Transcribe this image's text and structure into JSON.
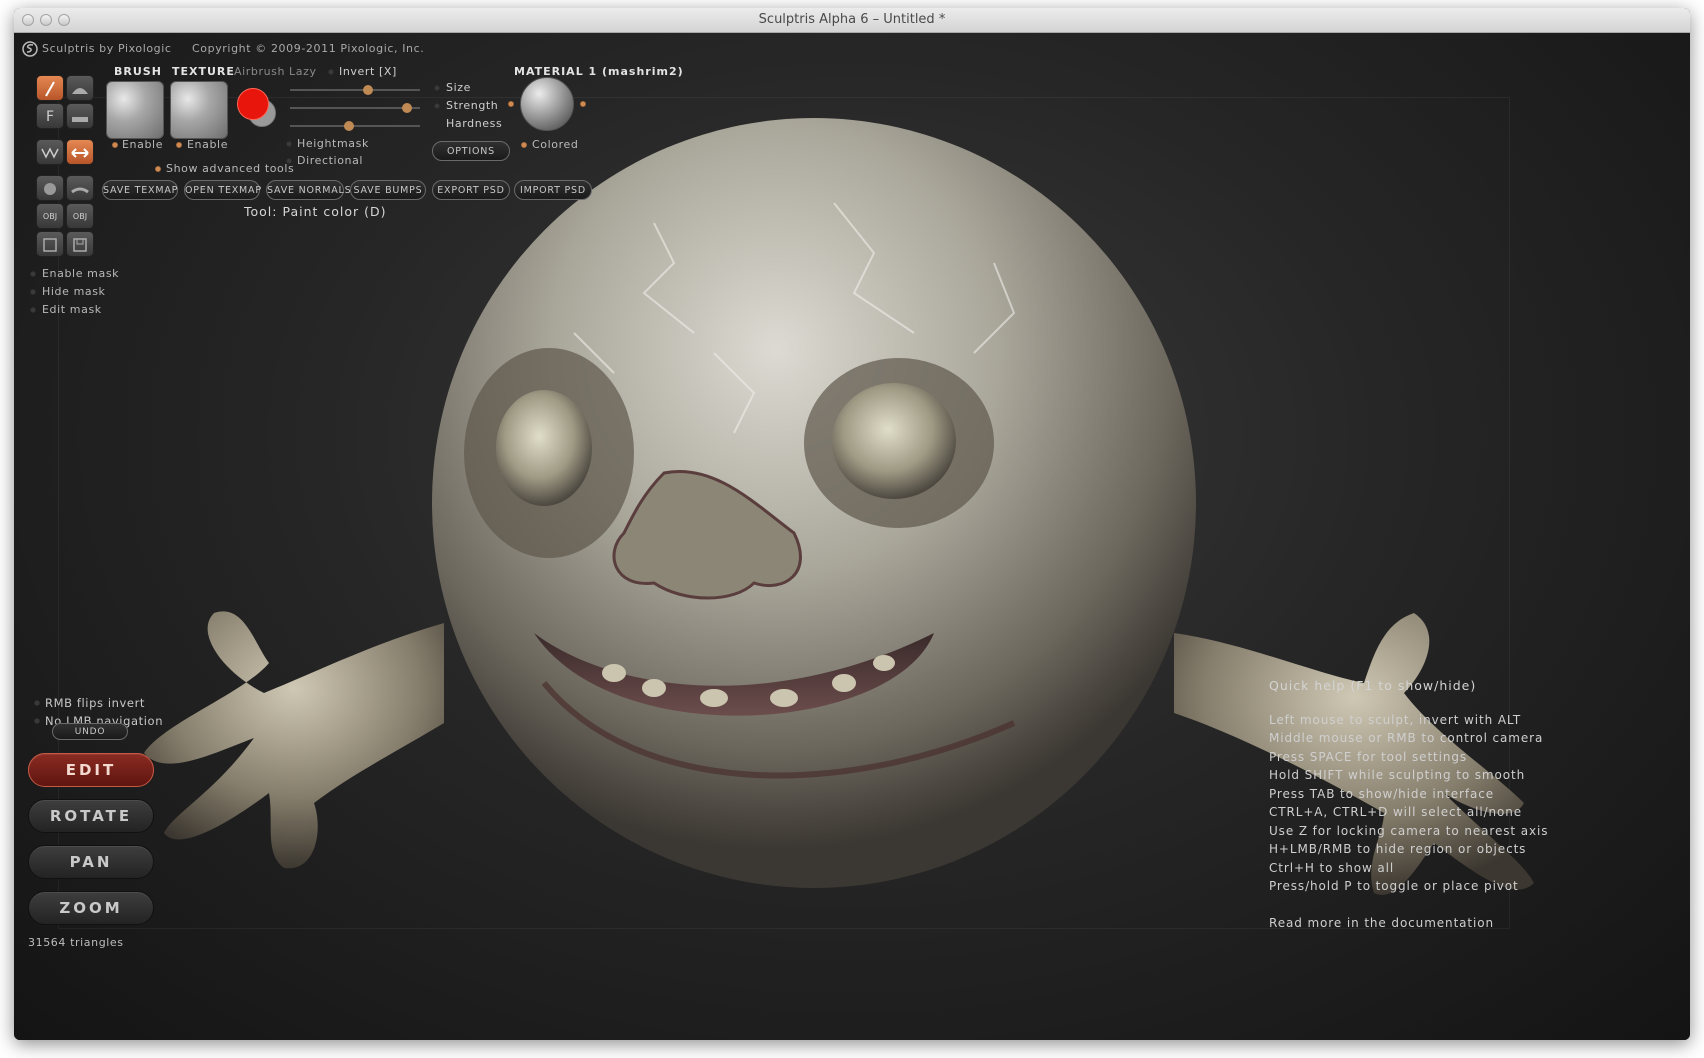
{
  "window": {
    "title": "Sculptris Alpha 6 – Untitled *"
  },
  "app_bar": {
    "title": "Sculptris by Pixologic",
    "copyright": "Copyright © 2009-2011 Pixologic, Inc."
  },
  "tools": {
    "brush_header": "BRUSH",
    "texture_header": "TEXTURE",
    "airbrush_label": "Airbrush",
    "lazy_label": "Lazy",
    "invert_label": "Invert [X]",
    "brush_enable": "Enable",
    "texture_enable": "Enable",
    "show_advanced": "Show advanced tools",
    "heightmask": "Heightmask",
    "directional": "Directional",
    "size_label": "Size",
    "strength_label": "Strength",
    "hardness_label": "Hardness",
    "size_value": 0.6,
    "strength_value": 0.9,
    "hardness_value": 0.45,
    "options_label": "OPTIONS",
    "material_header": "MATERIAL 1 (mashrim2)",
    "colored_label": "Colored",
    "paint_color": "#e8150c",
    "secondary_color": "#9a9a9a",
    "tool_status": "Tool: Paint color (D)"
  },
  "action_buttons": [
    "SAVE TEXMAP",
    "OPEN TEXMAP",
    "SAVE NORMALS",
    "SAVE BUMPS",
    "EXPORT PSD",
    "IMPORT PSD"
  ],
  "left_panel": {
    "tool_icons": [
      "paint-brush-icon",
      "sculpt-icon",
      "f-icon",
      "flatten-icon",
      "draw-icon",
      "grab-icon",
      "sphere-icon",
      "plane-icon",
      "obj-import-icon",
      "obj-export-icon",
      "save-icon",
      "load-icon"
    ],
    "tool_letters": {
      "f": "F",
      "obj1": "OBJ",
      "obj2": "OBJ"
    },
    "mask_options": [
      "Enable mask",
      "Hide mask",
      "Edit mask"
    ],
    "rmb_flips": "RMB flips invert",
    "no_lmb": "No LMB navigation",
    "undo": "UNDO",
    "modes": [
      "EDIT",
      "ROTATE",
      "PAN",
      "ZOOM"
    ],
    "active_mode": "EDIT",
    "triangles": "31564 triangles"
  },
  "quick_help": {
    "title": "Quick help (F1 to show/hide)",
    "lines": [
      "Left mouse to sculpt, invert with ALT",
      "Middle mouse or RMB to control camera",
      "Press SPACE for tool settings",
      "Hold SHIFT while sculpting to smooth",
      "Press TAB to show/hide interface",
      "CTRL+A, CTRL+D will select all/none",
      "Use Z for locking camera to nearest axis",
      "H+LMB/RMB to hide region or objects",
      "Ctrl+H to show all",
      "Press/hold P to toggle or place pivot"
    ],
    "footer": "Read more in the documentation"
  },
  "colors": {
    "accent": "#d77a43",
    "edit_active": "#7a2219"
  }
}
